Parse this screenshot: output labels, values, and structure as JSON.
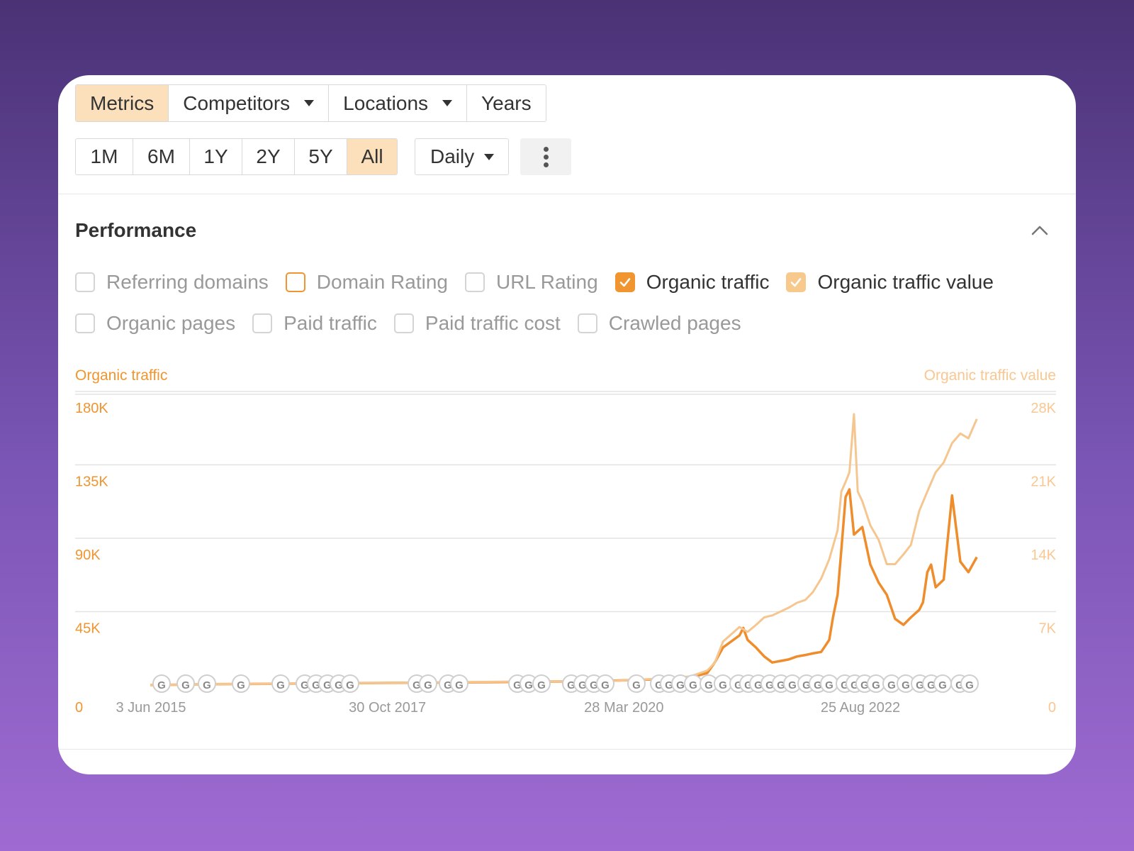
{
  "tabs": [
    {
      "label": "Metrics",
      "active": true,
      "dropdown": false
    },
    {
      "label": "Competitors",
      "active": false,
      "dropdown": true
    },
    {
      "label": "Locations",
      "active": false,
      "dropdown": true
    },
    {
      "label": "Years",
      "active": false,
      "dropdown": false
    }
  ],
  "ranges": [
    {
      "label": "1M",
      "active": false
    },
    {
      "label": "6M",
      "active": false
    },
    {
      "label": "1Y",
      "active": false
    },
    {
      "label": "2Y",
      "active": false
    },
    {
      "label": "5Y",
      "active": false
    },
    {
      "label": "All",
      "active": true
    }
  ],
  "granularity": {
    "label": "Daily"
  },
  "section": {
    "title": "Performance"
  },
  "metrics_row1": [
    {
      "label": "Referring domains",
      "state": "unchecked"
    },
    {
      "label": "Domain Rating",
      "state": "highlighted"
    },
    {
      "label": "URL Rating",
      "state": "unchecked"
    },
    {
      "label": "Organic traffic",
      "state": "checked"
    },
    {
      "label": "Organic traffic value",
      "state": "checked-light"
    }
  ],
  "metrics_row2": [
    {
      "label": "Organic pages",
      "state": "unchecked"
    },
    {
      "label": "Paid traffic",
      "state": "unchecked"
    },
    {
      "label": "Paid traffic cost",
      "state": "unchecked"
    },
    {
      "label": "Crawled pages",
      "state": "unchecked"
    }
  ],
  "colors": {
    "organic_traffic": "#ef8c2c",
    "organic_traffic_value": "#f5c68f",
    "active_tab": "#fbe0bb",
    "axis_left": "#f0952f",
    "axis_right": "#f8c792"
  },
  "icons": {
    "more": "more-vertical-icon",
    "collapse": "chevron-up-icon",
    "update_marker": "google-update-icon"
  },
  "chart_data": {
    "type": "line",
    "left_axis_label": "Organic traffic",
    "right_axis_label": "Organic traffic value",
    "y_ticks_left": [
      "0",
      "45K",
      "90K",
      "135K",
      "180K"
    ],
    "y_ticks_right": [
      "0",
      "7K",
      "14K",
      "21K",
      "28K"
    ],
    "ylim_left": [
      0,
      180000
    ],
    "ylim_right": [
      0,
      28000
    ],
    "x_ticks": [
      {
        "label": "3 Jun 2015",
        "date": "2015-06-03"
      },
      {
        "label": "30 Oct 2017",
        "date": "2017-10-30"
      },
      {
        "label": "28 Mar 2020",
        "date": "2020-03-28"
      },
      {
        "label": "25 Aug 2022",
        "date": "2022-08-25"
      }
    ],
    "grid": true,
    "series": [
      {
        "name": "Organic traffic",
        "axis": "left",
        "x": [
          "2015-06-01",
          "2016-01-01",
          "2017-01-01",
          "2018-01-01",
          "2019-01-01",
          "2019-09-01",
          "2020-03-01",
          "2020-09-01",
          "2020-12-01",
          "2021-02-01",
          "2021-03-01",
          "2021-04-01",
          "2021-06-01",
          "2021-06-15",
          "2021-07-01",
          "2021-08-01",
          "2021-09-01",
          "2021-10-01",
          "2021-11-01",
          "2021-12-01",
          "2022-01-01",
          "2022-02-01",
          "2022-03-01",
          "2022-04-01",
          "2022-05-01",
          "2022-05-15",
          "2022-06-01",
          "2022-06-15",
          "2022-07-01",
          "2022-07-15",
          "2022-08-01",
          "2022-09-01",
          "2022-10-01",
          "2022-11-01",
          "2022-12-01",
          "2023-01-01",
          "2023-02-01",
          "2023-03-01",
          "2023-04-01",
          "2023-04-15",
          "2023-05-01",
          "2023-05-15",
          "2023-06-01",
          "2023-07-01",
          "2023-08-01",
          "2023-09-01",
          "2023-10-01",
          "2023-11-01"
        ],
        "values": [
          0,
          600,
          1000,
          1500,
          2000,
          2500,
          3000,
          4000,
          5000,
          8000,
          15000,
          25000,
          33000,
          38000,
          30000,
          25000,
          19000,
          15000,
          16000,
          17000,
          19000,
          20000,
          21000,
          22000,
          30000,
          45000,
          60000,
          90000,
          125000,
          130000,
          100000,
          105000,
          80000,
          68000,
          60000,
          44000,
          40000,
          45000,
          50000,
          55000,
          75000,
          80000,
          65000,
          70000,
          126000,
          82000,
          75000,
          85000
        ]
      },
      {
        "name": "Organic traffic value",
        "axis": "right",
        "x": [
          "2015-06-01",
          "2016-01-01",
          "2017-01-01",
          "2018-01-01",
          "2019-01-01",
          "2019-09-01",
          "2020-03-01",
          "2020-09-01",
          "2020-12-01",
          "2021-02-01",
          "2021-03-01",
          "2021-04-01",
          "2021-06-01",
          "2021-07-01",
          "2021-08-01",
          "2021-09-01",
          "2021-10-01",
          "2021-11-01",
          "2021-12-01",
          "2022-01-01",
          "2022-02-01",
          "2022-03-01",
          "2022-04-01",
          "2022-05-01",
          "2022-06-01",
          "2022-06-15",
          "2022-07-01",
          "2022-07-15",
          "2022-08-01",
          "2022-08-15",
          "2022-09-01",
          "2022-10-01",
          "2022-11-01",
          "2022-12-01",
          "2023-01-01",
          "2023-02-01",
          "2023-03-01",
          "2023-04-01",
          "2023-05-01",
          "2023-06-01",
          "2023-07-01",
          "2023-08-01",
          "2023-09-01",
          "2023-10-01",
          "2023-11-01"
        ],
        "values": [
          0,
          100,
          150,
          250,
          350,
          400,
          450,
          700,
          900,
          1500,
          2300,
          4500,
          6000,
          5500,
          6200,
          7000,
          7200,
          7600,
          8000,
          8500,
          8800,
          9600,
          11000,
          13000,
          16000,
          20000,
          21000,
          22000,
          28000,
          20000,
          19000,
          16500,
          15000,
          12500,
          12500,
          13500,
          14500,
          18000,
          20000,
          22000,
          23000,
          25000,
          26000,
          25500,
          27500
        ]
      }
    ]
  }
}
